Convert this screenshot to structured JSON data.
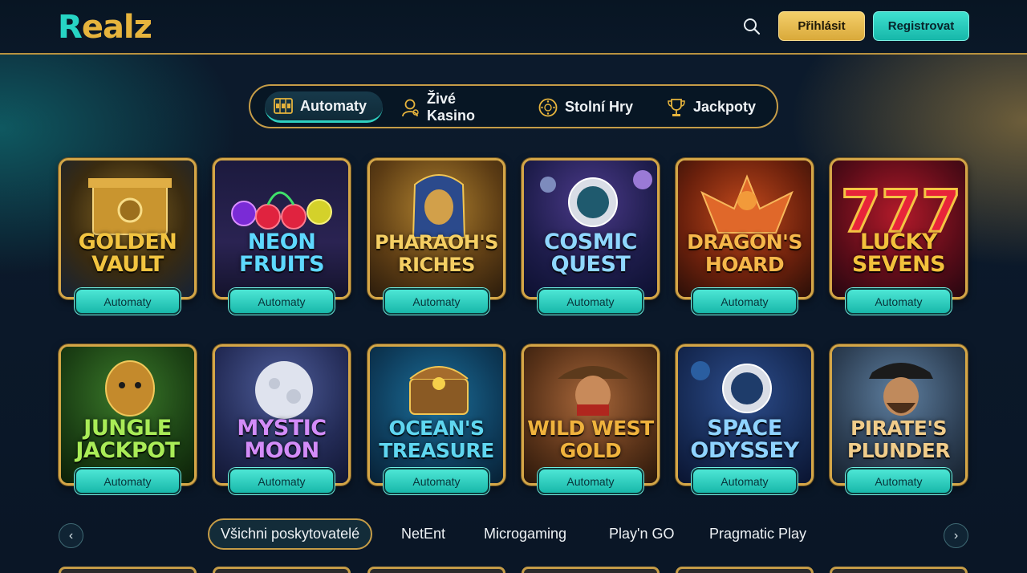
{
  "header": {
    "logo_r": "R",
    "logo_rest": "ealz",
    "search_icon": "search-icon",
    "login_label": "Přihlásit",
    "register_label": "Registrovat"
  },
  "tabs": [
    {
      "label": "Automaty",
      "icon": "slot-machine-icon",
      "active": true
    },
    {
      "label": "Živé Kasino",
      "icon": "dealer-icon",
      "active": false
    },
    {
      "label": "Stolní Hry",
      "icon": "roulette-icon",
      "active": false
    },
    {
      "label": "Jackpoty",
      "icon": "trophy-icon",
      "active": false
    }
  ],
  "games": [
    {
      "title": "GOLDEN\nVAULT",
      "category": "Automaty",
      "color": "#f2c440"
    },
    {
      "title": "NEON\nFRUITS",
      "category": "Automaty",
      "color": "#5ed8ff"
    },
    {
      "title": "PHARAOH'S\nRICHES",
      "category": "Automaty",
      "color": "#f5cf63"
    },
    {
      "title": "COSMIC\nQUEST",
      "category": "Automaty",
      "color": "#8fd7ff"
    },
    {
      "title": "DRAGON'S\nHOARD",
      "category": "Automaty",
      "color": "#f6b84a"
    },
    {
      "title": "LUCKY\nSEVENS",
      "category": "Automaty",
      "color": "#f3c13c"
    },
    {
      "title": "JUNGLE\nJACKPOT",
      "category": "Automaty",
      "color": "#a9ec57"
    },
    {
      "title": "MYSTIC\nMOON",
      "category": "Automaty",
      "color": "#d38cf8"
    },
    {
      "title": "OCEAN'S\nTREASURE",
      "category": "Automaty",
      "color": "#5fd6f0"
    },
    {
      "title": "WILD WEST\nGOLD",
      "category": "Automaty",
      "color": "#f0b33d"
    },
    {
      "title": "SPACE\nODYSSEY",
      "category": "Automaty",
      "color": "#8fd3ff"
    },
    {
      "title": "PIRATE'S\nPLUNDER",
      "category": "Automaty",
      "color": "#f0cc8a"
    }
  ],
  "providers": {
    "prev_icon": "chevron-left-icon",
    "next_icon": "chevron-right-icon",
    "items": [
      {
        "label": "Všichni poskytovatelé",
        "active": true
      },
      {
        "label": "NetEnt",
        "active": false
      },
      {
        "label": "Microgaming",
        "active": false
      },
      {
        "label": "Play'n GO",
        "active": false
      },
      {
        "label": "Pragmatic Play",
        "active": false
      }
    ]
  }
}
